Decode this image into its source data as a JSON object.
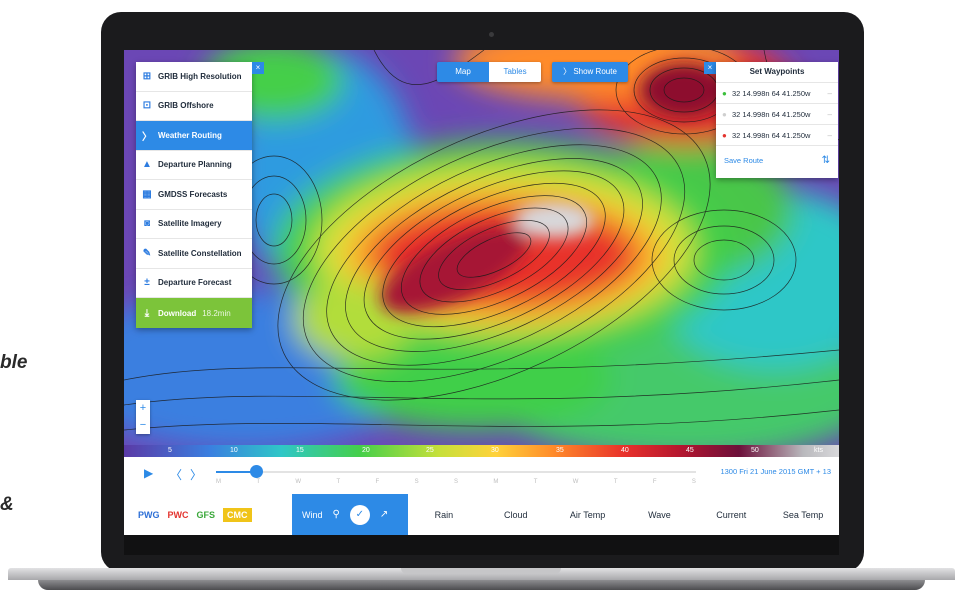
{
  "side_text": [
    "ble",
    "&"
  ],
  "menu": {
    "items": [
      {
        "icon": "grib-icon",
        "glyph": "⊞",
        "label": "GRIB High Resolution"
      },
      {
        "icon": "grib-offshore-icon",
        "glyph": "⊡",
        "label": "GRIB Offshore"
      },
      {
        "icon": "route-icon",
        "glyph": "〉",
        "label": "Weather Routing",
        "active": true
      },
      {
        "icon": "triangle-icon",
        "glyph": "▲",
        "label": "Departure Planning"
      },
      {
        "icon": "grid-icon",
        "glyph": "▦",
        "label": "GMDSS Forecasts"
      },
      {
        "icon": "camera-icon",
        "glyph": "◙",
        "label": "Satellite Imagery"
      },
      {
        "icon": "satellite-icon",
        "glyph": "✎",
        "label": "Satellite Constellation"
      },
      {
        "icon": "departure-icon",
        "glyph": "±",
        "label": "Departure Forecast"
      }
    ],
    "download_label": "Download",
    "download_size": "18.2min"
  },
  "view_toggle": {
    "map": "Map",
    "tables": "Tables"
  },
  "show_route_label": "Show Route",
  "waypoints": {
    "title": "Set Waypoints",
    "rows": [
      {
        "coord": "32 14.998n 64 41.250w",
        "color": "#3cbf3c"
      },
      {
        "coord": "32 14.998n 64 41.250w",
        "color": "#cfcfcf"
      },
      {
        "coord": "32 14.998n 64 41.250w",
        "color": "#e3342f"
      }
    ],
    "save_label": "Save Route"
  },
  "scale_labels": [
    "5",
    "10",
    "15",
    "20",
    "25",
    "30",
    "35",
    "40",
    "45",
    "50",
    "kts"
  ],
  "timeline": {
    "days": [
      "M",
      "T",
      "W",
      "T",
      "F",
      "S",
      "S",
      "M",
      "T",
      "W",
      "T",
      "F",
      "S"
    ],
    "date": "1300 Fri 21 June 2015 GMT + 13"
  },
  "models": [
    {
      "label": "PWG",
      "color": "#2d6fd6"
    },
    {
      "label": "PWC",
      "color": "#e3342f"
    },
    {
      "label": "GFS",
      "color": "#3aa83a"
    },
    {
      "label": "CMC",
      "color": "#ffffff"
    }
  ],
  "wind_label": "Wind",
  "layers": [
    "Rain",
    "Cloud",
    "Air Temp",
    "Wave",
    "Current",
    "Sea Temp"
  ]
}
